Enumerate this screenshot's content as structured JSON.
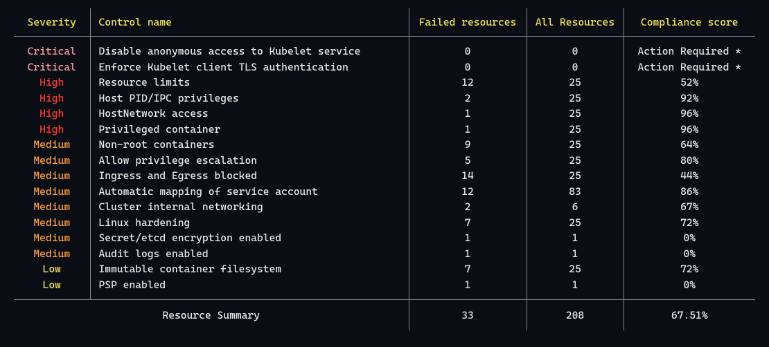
{
  "headers": {
    "severity": "Severity",
    "control_name": "Control name",
    "failed": "Failed resources",
    "all": "All Resources",
    "compliance": "Compliance score"
  },
  "rows": [
    {
      "severity": "Critical",
      "control": "Disable anonymous access to Kubelet service",
      "failed": "0",
      "all": "0",
      "compliance": "Action Required *"
    },
    {
      "severity": "Critical",
      "control": "Enforce Kubelet client TLS authentication",
      "failed": "0",
      "all": "0",
      "compliance": "Action Required *"
    },
    {
      "severity": "High",
      "control": "Resource limits",
      "failed": "12",
      "all": "25",
      "compliance": "52%"
    },
    {
      "severity": "High",
      "control": "Host PID/IPC privileges",
      "failed": "2",
      "all": "25",
      "compliance": "92%"
    },
    {
      "severity": "High",
      "control": "HostNetwork access",
      "failed": "1",
      "all": "25",
      "compliance": "96%"
    },
    {
      "severity": "High",
      "control": "Privileged container",
      "failed": "1",
      "all": "25",
      "compliance": "96%"
    },
    {
      "severity": "Medium",
      "control": "Non-root containers",
      "failed": "9",
      "all": "25",
      "compliance": "64%"
    },
    {
      "severity": "Medium",
      "control": "Allow privilege escalation",
      "failed": "5",
      "all": "25",
      "compliance": "80%"
    },
    {
      "severity": "Medium",
      "control": "Ingress and Egress blocked",
      "failed": "14",
      "all": "25",
      "compliance": "44%"
    },
    {
      "severity": "Medium",
      "control": "Automatic mapping of service account",
      "failed": "12",
      "all": "83",
      "compliance": "86%"
    },
    {
      "severity": "Medium",
      "control": "Cluster internal networking",
      "failed": "2",
      "all": "6",
      "compliance": "67%"
    },
    {
      "severity": "Medium",
      "control": "Linux hardening",
      "failed": "7",
      "all": "25",
      "compliance": "72%"
    },
    {
      "severity": "Medium",
      "control": "Secret/etcd encryption enabled",
      "failed": "1",
      "all": "1",
      "compliance": "0%"
    },
    {
      "severity": "Medium",
      "control": "Audit logs enabled",
      "failed": "1",
      "all": "1",
      "compliance": "0%"
    },
    {
      "severity": "Low",
      "control": "Immutable container filesystem",
      "failed": "7",
      "all": "25",
      "compliance": "72%"
    },
    {
      "severity": "Low",
      "control": "PSP enabled",
      "failed": "1",
      "all": "1",
      "compliance": "0%"
    }
  ],
  "summary": {
    "label": "Resource Summary",
    "failed": "33",
    "all": "208",
    "compliance": "67.51%"
  },
  "colors": {
    "header": "#f1e65a",
    "critical": "#ff9aa2",
    "high": "#ff3b30",
    "medium": "#ff9f43",
    "low": "#f1e65a",
    "border": "#8a8a8a",
    "bg": "#0a0e14",
    "fg": "#e8e8e8"
  }
}
